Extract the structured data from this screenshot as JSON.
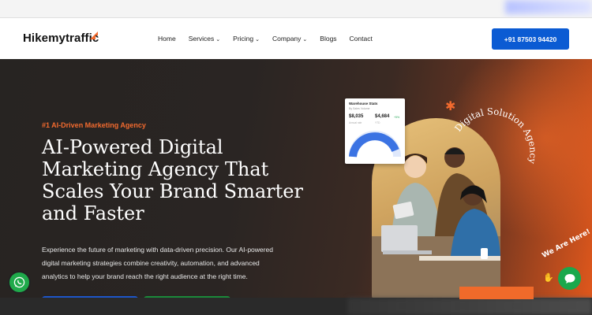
{
  "header": {
    "logo_text": "Hikemytraffic",
    "nav": [
      {
        "label": "Home",
        "has_dropdown": false
      },
      {
        "label": "Services",
        "has_dropdown": true
      },
      {
        "label": "Pricing",
        "has_dropdown": true
      },
      {
        "label": "Company",
        "has_dropdown": true
      },
      {
        "label": "Blogs",
        "has_dropdown": false
      },
      {
        "label": "Contact",
        "has_dropdown": false
      }
    ],
    "phone": "+91 87503 94420"
  },
  "hero": {
    "tagline": "#1 AI-Driven Marketing Agency",
    "headline": "AI-Powered Digital Marketing Agency That Scales Your Brand Smarter and Faster",
    "description": "Experience the future of marketing with data-driven precision. Our AI-powered digital marketing strategies combine creativity, automation, and advanced analytics to help your brand reach the right audience at the right time.",
    "badge_text": "Digital Solution Agency"
  },
  "stats_card": {
    "title": "Warehouse Stats",
    "subtitle": "By Sales Volume",
    "value_a": "$8,035",
    "label_a": "Annual rate",
    "value_b": "$4,684",
    "badge_b": "+5%",
    "label_b": "YTD"
  },
  "chat": {
    "label": "We Are Here!"
  },
  "colors": {
    "accent": "#f26a2e",
    "primary": "#0b5bd3",
    "whatsapp": "#1faa4b"
  }
}
